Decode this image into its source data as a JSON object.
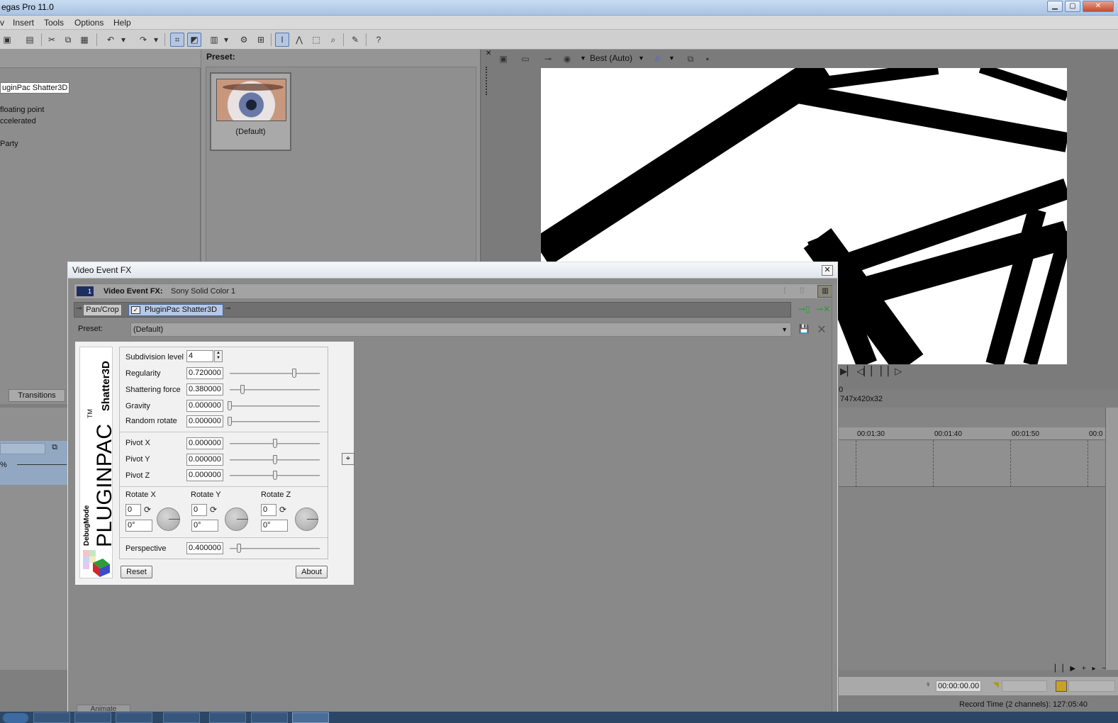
{
  "app": {
    "title": "egas Pro 11.0"
  },
  "window_controls": {
    "minimize": "▁",
    "maximize": "▢",
    "close": "✕"
  },
  "menu": [
    "v",
    "Insert",
    "Tools",
    "Options",
    "Help"
  ],
  "left_panel": {
    "selected_plugin": "uginPac Shatter3D",
    "info_lines": [
      "floating point",
      "ccelerated",
      "Party"
    ],
    "tab_transitions": "Transitions",
    "pct": "%"
  },
  "preset_panel": {
    "label": "Preset:",
    "thumb_label": "(Default)"
  },
  "preview": {
    "quality": "Best (Auto)",
    "resolution_a": "0",
    "resolution_b": "747x420x32"
  },
  "timeline": {
    "ticks": [
      "00:01:30",
      "00:01:40",
      "00:01:50",
      "00:0"
    ],
    "time_display": "00:00:00.00",
    "record_time": "Record Time (2 channels): 127:05:40"
  },
  "fx_window": {
    "title": "Video Event FX",
    "close": "✕",
    "slot_number": "1",
    "header_label": "Video Event FX:",
    "header_value": "Sony Solid Color 1",
    "chain": [
      "Pan/Crop",
      "PluginPac Shatter3D"
    ],
    "preset_label": "Preset:",
    "preset_value": "(Default)",
    "tab_animate": "Animate"
  },
  "plugin": {
    "logo_brand": "PLUGINPAC",
    "logo_tm": "TM",
    "logo_vendor": "DebugMode",
    "logo_product": "Shatter3D",
    "subdivision_label": "Subdivision level",
    "subdivision_value": "4",
    "params": [
      {
        "label": "Regularity",
        "value": "0.720000",
        "level": 0.72
      },
      {
        "label": "Shattering force",
        "value": "0.380000",
        "level": 0.14
      },
      {
        "label": "Gravity",
        "value": "0.000000",
        "level": 0.0
      },
      {
        "label": "Random rotate",
        "value": "0.000000",
        "level": 0.0
      }
    ],
    "pivots": [
      {
        "label": "Pivot X",
        "value": "0.000000",
        "level": 0.5
      },
      {
        "label": "Pivot Y",
        "value": "0.000000",
        "level": 0.5
      },
      {
        "label": "Pivot Z",
        "value": "0.000000",
        "level": 0.5
      }
    ],
    "rotations": [
      {
        "label": "Rotate X",
        "turns": "0",
        "degrees": "0°"
      },
      {
        "label": "Rotate Y",
        "turns": "0",
        "degrees": "0°"
      },
      {
        "label": "Rotate Z",
        "turns": "0",
        "degrees": "0°"
      }
    ],
    "perspective_label": "Perspective",
    "perspective_value": "0.400000",
    "perspective_level": 0.1,
    "reset_label": "Reset",
    "about_label": "About"
  }
}
